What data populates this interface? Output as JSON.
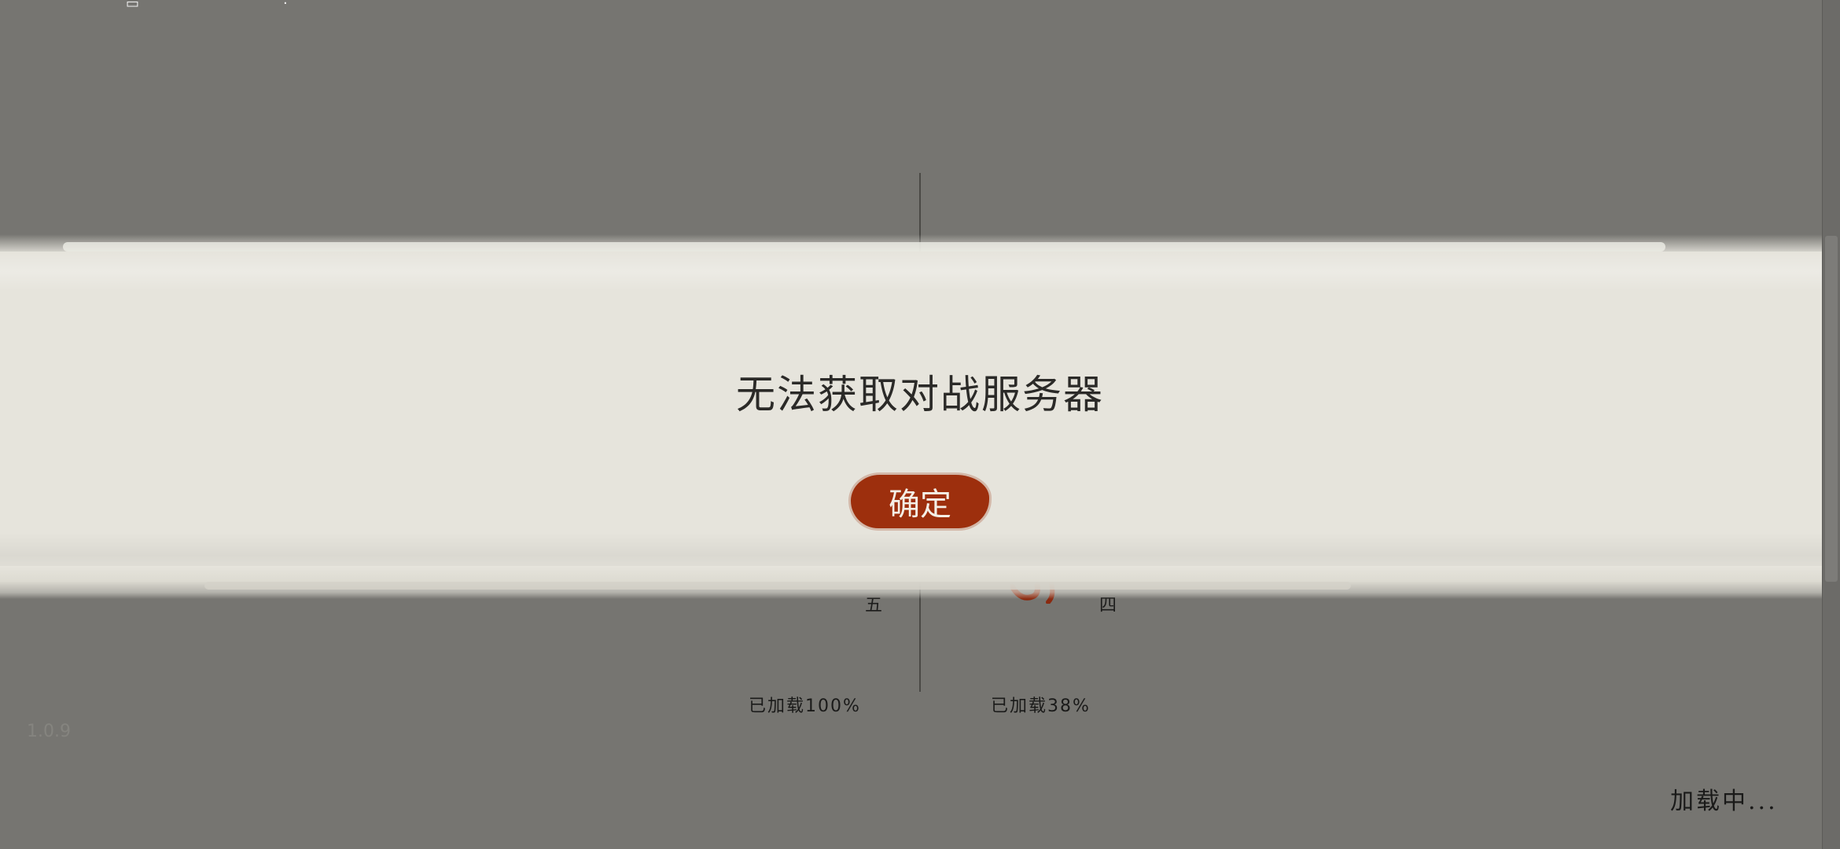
{
  "dialog": {
    "title": "无法获取对战服务器",
    "confirm_label": "确定"
  },
  "players": {
    "left": {
      "seat_label": "五",
      "load_text": "已加载100%",
      "load_progress": 1.0
    },
    "right": {
      "seat_label": "四",
      "load_text": "已加载38%",
      "load_progress": 0.38
    }
  },
  "footer": {
    "version": "1.0.9",
    "loading_label": "加载中..."
  },
  "colors": {
    "background": "#767571",
    "band": "#e6e4dc",
    "button": "#9d2f0d"
  }
}
